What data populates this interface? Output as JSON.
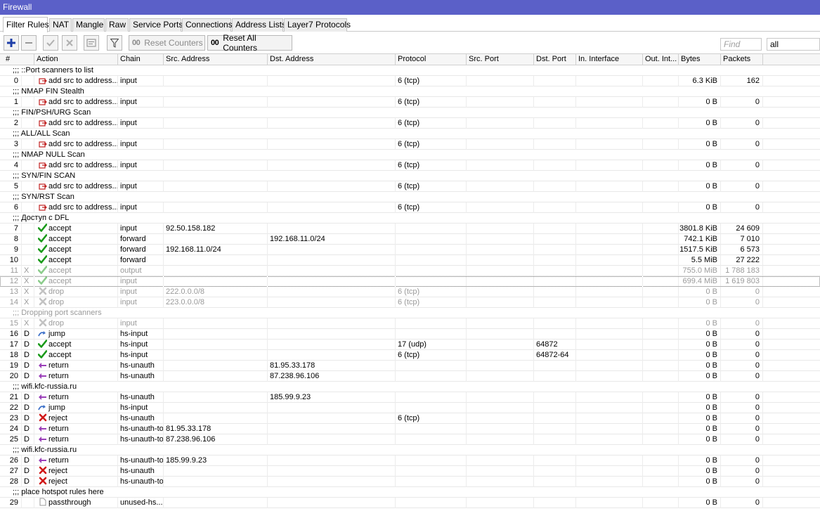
{
  "window_title": "Firewall",
  "tabs": [
    {
      "label": "Filter Rules",
      "active": true
    },
    {
      "label": "NAT"
    },
    {
      "label": "Mangle"
    },
    {
      "label": "Raw"
    },
    {
      "label": "Service Ports"
    },
    {
      "label": "Connections"
    },
    {
      "label": "Address Lists"
    },
    {
      "label": "Layer7 Protocols"
    }
  ],
  "toolbar": {
    "add_icon": "plus-icon",
    "remove_icon": "minus-icon",
    "enable_icon": "check-icon",
    "disable_icon": "x-icon",
    "comment_icon": "comment-icon",
    "filter_icon": "filter-icon",
    "reset_counters_label": "Reset Counters",
    "reset_all_counters_label": "Reset All Counters",
    "counter_icon_text": "00",
    "find_placeholder": "Find",
    "filter_select_value": "all"
  },
  "columns": [
    "#",
    "Action",
    "Chain",
    "Src. Address",
    "Dst. Address",
    "Protocol",
    "Src. Port",
    "Dst. Port",
    "In. Interface",
    "Out. Int...",
    "Bytes",
    "Packets"
  ],
  "rows": [
    {
      "comment": ";;; ::Port scanners to list"
    },
    {
      "num": "0",
      "flag": "",
      "icon": "address-list-icon",
      "action": "add src to address...",
      "chain": "input",
      "src": "",
      "dst": "",
      "proto": "6 (tcp)",
      "sport": "",
      "dport": "",
      "inif": "",
      "outif": "",
      "bytes": "6.3 KiB",
      "packets": "162"
    },
    {
      "comment": ";;; NMAP FIN Stealth"
    },
    {
      "num": "1",
      "flag": "",
      "icon": "address-list-icon",
      "action": "add src to address...",
      "chain": "input",
      "src": "",
      "dst": "",
      "proto": "6 (tcp)",
      "sport": "",
      "dport": "",
      "inif": "",
      "outif": "",
      "bytes": "0 B",
      "packets": "0"
    },
    {
      "comment": ";;; FIN/PSH/URG Scan"
    },
    {
      "num": "2",
      "flag": "",
      "icon": "address-list-icon",
      "action": "add src to address...",
      "chain": "input",
      "src": "",
      "dst": "",
      "proto": "6 (tcp)",
      "sport": "",
      "dport": "",
      "inif": "",
      "outif": "",
      "bytes": "0 B",
      "packets": "0"
    },
    {
      "comment": ";;; ALL/ALL Scan"
    },
    {
      "num": "3",
      "flag": "",
      "icon": "address-list-icon",
      "action": "add src to address...",
      "chain": "input",
      "src": "",
      "dst": "",
      "proto": "6 (tcp)",
      "sport": "",
      "dport": "",
      "inif": "",
      "outif": "",
      "bytes": "0 B",
      "packets": "0"
    },
    {
      "comment": ";;; NMAP NULL Scan"
    },
    {
      "num": "4",
      "flag": "",
      "icon": "address-list-icon",
      "action": "add src to address...",
      "chain": "input",
      "src": "",
      "dst": "",
      "proto": "6 (tcp)",
      "sport": "",
      "dport": "",
      "inif": "",
      "outif": "",
      "bytes": "0 B",
      "packets": "0"
    },
    {
      "comment": ";;; SYN/FIN SCAN"
    },
    {
      "num": "5",
      "flag": "",
      "icon": "address-list-icon",
      "action": "add src to address...",
      "chain": "input",
      "src": "",
      "dst": "",
      "proto": "6 (tcp)",
      "sport": "",
      "dport": "",
      "inif": "",
      "outif": "",
      "bytes": "0 B",
      "packets": "0"
    },
    {
      "comment": ";;; SYN/RST Scan"
    },
    {
      "num": "6",
      "flag": "",
      "icon": "address-list-icon",
      "action": "add src to address...",
      "chain": "input",
      "src": "",
      "dst": "",
      "proto": "6 (tcp)",
      "sport": "",
      "dport": "",
      "inif": "",
      "outif": "",
      "bytes": "0 B",
      "packets": "0"
    },
    {
      "comment": ";;; Доступ с DFL"
    },
    {
      "num": "7",
      "flag": "",
      "icon": "accept-icon",
      "action": "accept",
      "chain": "input",
      "src": "92.50.158.182",
      "dst": "",
      "proto": "",
      "sport": "",
      "dport": "",
      "inif": "",
      "outif": "",
      "bytes": "3801.8 KiB",
      "packets": "24 609"
    },
    {
      "num": "8",
      "flag": "",
      "icon": "accept-icon",
      "action": "accept",
      "chain": "forward",
      "src": "",
      "dst": "192.168.11.0/24",
      "proto": "",
      "sport": "",
      "dport": "",
      "inif": "",
      "outif": "",
      "bytes": "742.1 KiB",
      "packets": "7 010"
    },
    {
      "num": "9",
      "flag": "",
      "icon": "accept-icon",
      "action": "accept",
      "chain": "forward",
      "src": "192.168.11.0/24",
      "dst": "",
      "proto": "",
      "sport": "",
      "dport": "",
      "inif": "",
      "outif": "",
      "bytes": "1517.5 KiB",
      "packets": "6 573"
    },
    {
      "num": "10",
      "flag": "",
      "icon": "accept-icon",
      "action": "accept",
      "chain": "forward",
      "src": "",
      "dst": "",
      "proto": "",
      "sport": "",
      "dport": "",
      "inif": "",
      "outif": "",
      "bytes": "5.5 MiB",
      "packets": "27 222"
    },
    {
      "num": "11",
      "flag": "X",
      "disabled": true,
      "icon": "accept-icon",
      "action": "accept",
      "chain": "output",
      "src": "",
      "dst": "",
      "proto": "",
      "sport": "",
      "dport": "",
      "inif": "",
      "outif": "",
      "bytes": "755.0 MiB",
      "packets": "1 788 183"
    },
    {
      "num": "12",
      "flag": "X",
      "disabled": true,
      "selected": true,
      "icon": "accept-icon",
      "action": "accept",
      "chain": "input",
      "src": "",
      "dst": "",
      "proto": "",
      "sport": "",
      "dport": "",
      "inif": "",
      "outif": "",
      "bytes": "699.4 MiB",
      "packets": "1 619 803"
    },
    {
      "num": "13",
      "flag": "X",
      "disabled": true,
      "icon": "drop-icon",
      "action": "drop",
      "chain": "input",
      "src": "222.0.0.0/8",
      "dst": "",
      "proto": "6 (tcp)",
      "sport": "",
      "dport": "",
      "inif": "",
      "outif": "",
      "bytes": "0 B",
      "packets": "0"
    },
    {
      "num": "14",
      "flag": "X",
      "disabled": true,
      "icon": "drop-icon",
      "action": "drop",
      "chain": "input",
      "src": "223.0.0.0/8",
      "dst": "",
      "proto": "6 (tcp)",
      "sport": "",
      "dport": "",
      "inif": "",
      "outif": "",
      "bytes": "0 B",
      "packets": "0"
    },
    {
      "comment": ";;; Dropping port scanners",
      "disabled": true
    },
    {
      "num": "15",
      "flag": "X",
      "disabled": true,
      "icon": "drop-icon",
      "action": "drop",
      "chain": "input",
      "src": "",
      "dst": "",
      "proto": "",
      "sport": "",
      "dport": "",
      "inif": "",
      "outif": "",
      "bytes": "0 B",
      "packets": "0"
    },
    {
      "num": "16",
      "flag": "D",
      "icon": "jump-icon",
      "action": "jump",
      "chain": "hs-input",
      "src": "",
      "dst": "",
      "proto": "",
      "sport": "",
      "dport": "",
      "inif": "",
      "outif": "",
      "bytes": "0 B",
      "packets": "0"
    },
    {
      "num": "17",
      "flag": "D",
      "icon": "accept-icon",
      "action": "accept",
      "chain": "hs-input",
      "src": "",
      "dst": "",
      "proto": "17 (udp)",
      "sport": "",
      "dport": "64872",
      "inif": "",
      "outif": "",
      "bytes": "0 B",
      "packets": "0"
    },
    {
      "num": "18",
      "flag": "D",
      "icon": "accept-icon",
      "action": "accept",
      "chain": "hs-input",
      "src": "",
      "dst": "",
      "proto": "6 (tcp)",
      "sport": "",
      "dport": "64872-64",
      "inif": "",
      "outif": "",
      "bytes": "0 B",
      "packets": "0"
    },
    {
      "num": "19",
      "flag": "D",
      "icon": "return-icon",
      "action": "return",
      "chain": "hs-unauth",
      "src": "",
      "dst": "81.95.33.178",
      "proto": "",
      "sport": "",
      "dport": "",
      "inif": "",
      "outif": "",
      "bytes": "0 B",
      "packets": "0"
    },
    {
      "num": "20",
      "flag": "D",
      "icon": "return-icon",
      "action": "return",
      "chain": "hs-unauth",
      "src": "",
      "dst": "87.238.96.106",
      "proto": "",
      "sport": "",
      "dport": "",
      "inif": "",
      "outif": "",
      "bytes": "0 B",
      "packets": "0"
    },
    {
      "comment": ";;; wifi.kfc-russia.ru"
    },
    {
      "num": "21",
      "flag": "D",
      "icon": "return-icon",
      "action": "return",
      "chain": "hs-unauth",
      "src": "",
      "dst": "185.99.9.23",
      "proto": "",
      "sport": "",
      "dport": "",
      "inif": "",
      "outif": "",
      "bytes": "0 B",
      "packets": "0"
    },
    {
      "num": "22",
      "flag": "D",
      "icon": "jump-icon",
      "action": "jump",
      "chain": "hs-input",
      "src": "",
      "dst": "",
      "proto": "",
      "sport": "",
      "dport": "",
      "inif": "",
      "outif": "",
      "bytes": "0 B",
      "packets": "0"
    },
    {
      "num": "23",
      "flag": "D",
      "icon": "reject-icon",
      "action": "reject",
      "chain": "hs-unauth",
      "src": "",
      "dst": "",
      "proto": "6 (tcp)",
      "sport": "",
      "dport": "",
      "inif": "",
      "outif": "",
      "bytes": "0 B",
      "packets": "0"
    },
    {
      "num": "24",
      "flag": "D",
      "icon": "return-icon",
      "action": "return",
      "chain": "hs-unauth-to",
      "src": "81.95.33.178",
      "dst": "",
      "proto": "",
      "sport": "",
      "dport": "",
      "inif": "",
      "outif": "",
      "bytes": "0 B",
      "packets": "0"
    },
    {
      "num": "25",
      "flag": "D",
      "icon": "return-icon",
      "action": "return",
      "chain": "hs-unauth-to",
      "src": "87.238.96.106",
      "dst": "",
      "proto": "",
      "sport": "",
      "dport": "",
      "inif": "",
      "outif": "",
      "bytes": "0 B",
      "packets": "0"
    },
    {
      "comment": ";;; wifi.kfc-russia.ru"
    },
    {
      "num": "26",
      "flag": "D",
      "icon": "return-icon",
      "action": "return",
      "chain": "hs-unauth-to",
      "src": "185.99.9.23",
      "dst": "",
      "proto": "",
      "sport": "",
      "dport": "",
      "inif": "",
      "outif": "",
      "bytes": "0 B",
      "packets": "0"
    },
    {
      "num": "27",
      "flag": "D",
      "icon": "reject-icon",
      "action": "reject",
      "chain": "hs-unauth",
      "src": "",
      "dst": "",
      "proto": "",
      "sport": "",
      "dport": "",
      "inif": "",
      "outif": "",
      "bytes": "0 B",
      "packets": "0"
    },
    {
      "num": "28",
      "flag": "D",
      "icon": "reject-icon",
      "action": "reject",
      "chain": "hs-unauth-to",
      "src": "",
      "dst": "",
      "proto": "",
      "sport": "",
      "dport": "",
      "inif": "",
      "outif": "",
      "bytes": "0 B",
      "packets": "0"
    },
    {
      "comment": ";;; place hotspot rules here"
    },
    {
      "num": "29",
      "flag": "",
      "icon": "passthrough-icon",
      "action": "passthrough",
      "chain": "unused-hs...",
      "src": "",
      "dst": "",
      "proto": "",
      "sport": "",
      "dport": "",
      "inif": "",
      "outif": "",
      "bytes": "0 B",
      "packets": "0"
    }
  ]
}
